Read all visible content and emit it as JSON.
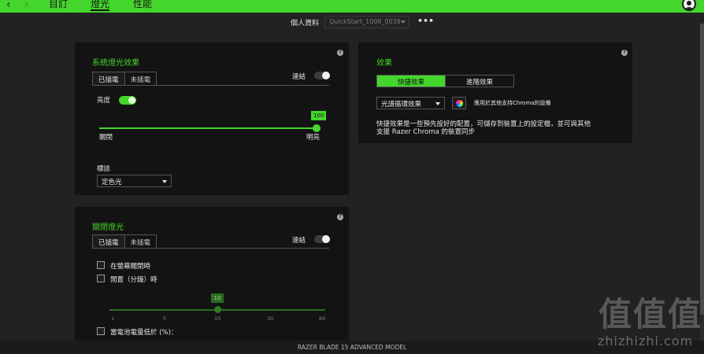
{
  "nav": {
    "back": "‹",
    "forward": "›",
    "tabs": [
      "目訂",
      "燈光",
      "性能"
    ],
    "active_tab": "燈光"
  },
  "profile": {
    "label": "個人資料",
    "selected": "QuickStart_1008_0038",
    "more": "•••"
  },
  "system_lighting": {
    "title": "系統燈光效果",
    "help": "?",
    "tabs": [
      "已插電",
      "未插電"
    ],
    "link_label": "連結",
    "brightness_label": "亮度",
    "brightness_value": "100",
    "slider_min_label": "關閉",
    "slider_max_label": "明亮",
    "logo_label": "標誌",
    "logo_value": "定色光"
  },
  "lighting_off": {
    "title": "關閉燈光",
    "help": "?",
    "tabs": [
      "已插電",
      "未插電"
    ],
    "link_label": "連結",
    "screen_off_label": "在螢幕關閉時",
    "idle_label": "閒置（分鐘）時",
    "idle_value": "10",
    "ticks": [
      "1",
      "5",
      "10",
      "30",
      "60"
    ],
    "battery_label": "當電池電量低於 (%)："
  },
  "effects": {
    "title": "效果",
    "help": "?",
    "quick_label": "快捷效果",
    "advanced_label": "進階效果",
    "effect_value": "光譜循環效果",
    "apply_label": "應用於其他支持Chroma的設備",
    "description_line1": "快捷效果是一些預先設好的配置，可儲存到裝置上的設定檔，並可與其他",
    "description_line2": "支援 Razer Chroma 的裝置同步"
  },
  "footer": {
    "device": "RAZER BLADE 15 ADVANCED MODEL"
  },
  "watermark": {
    "big": "值值值",
    "small": "zhizhizhi.com"
  },
  "colors": {
    "accent": "#44d62c",
    "panel": "#131313",
    "background": "#222222"
  }
}
